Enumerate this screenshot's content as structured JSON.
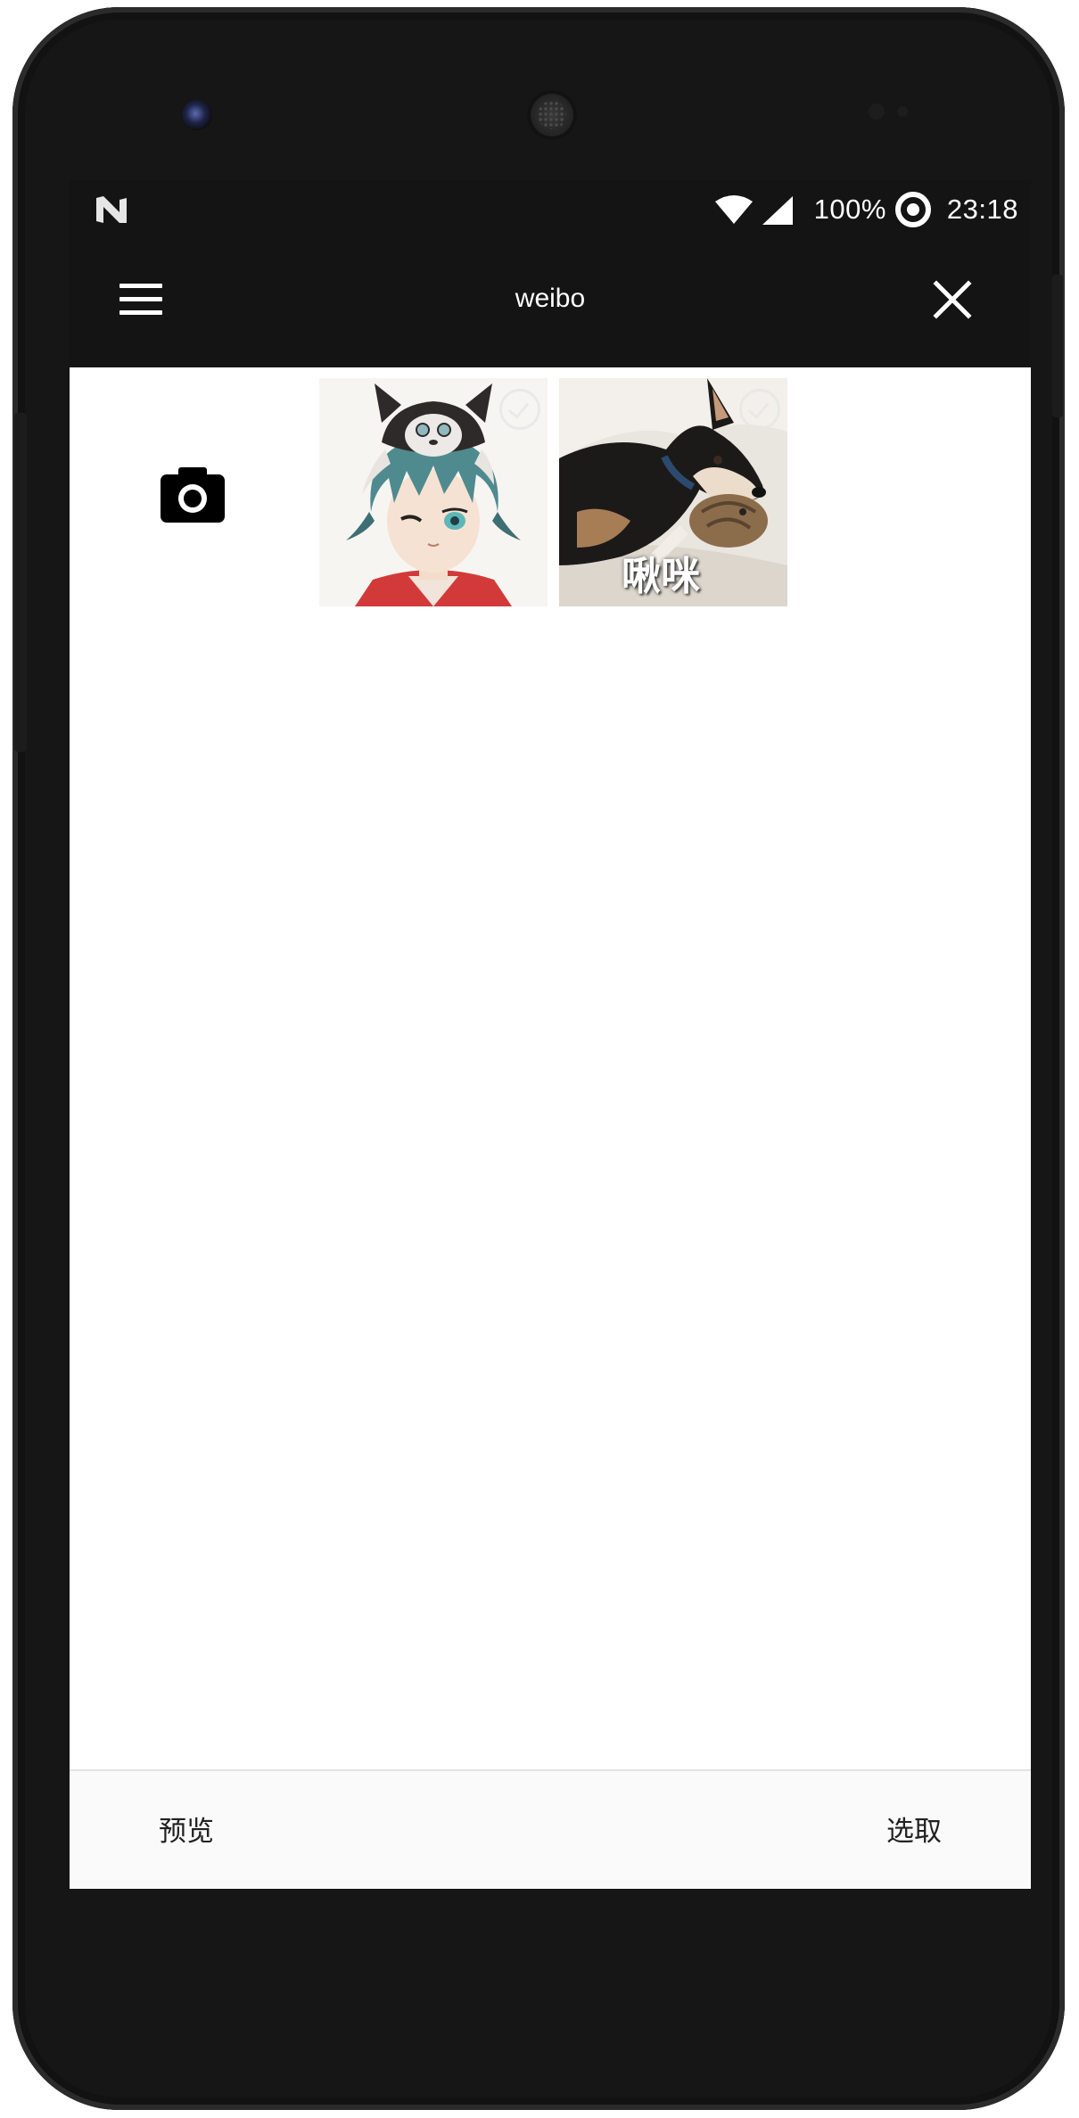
{
  "status_bar": {
    "battery_percent": "100%",
    "time": "23:18",
    "icons": [
      "n-logo-icon",
      "wifi-icon",
      "cell-signal-icon",
      "sync-icon"
    ]
  },
  "toolbar": {
    "title": "weibo",
    "menu_icon": "hamburger-menu-icon",
    "close_icon": "close-icon"
  },
  "gallery": {
    "camera_icon": "camera-icon",
    "photos": [
      {
        "subject": "anime-boy-with-dog-hat",
        "selected": false
      },
      {
        "subject": "dog-biting-cat",
        "caption": "啾咪",
        "selected": false
      }
    ]
  },
  "bottom_bar": {
    "preview_label": "预览",
    "select_label": "选取"
  },
  "colors": {
    "bar_background": "#141414",
    "screen_background": "#ffffff",
    "bottom_bar_background": "#fafafa"
  }
}
